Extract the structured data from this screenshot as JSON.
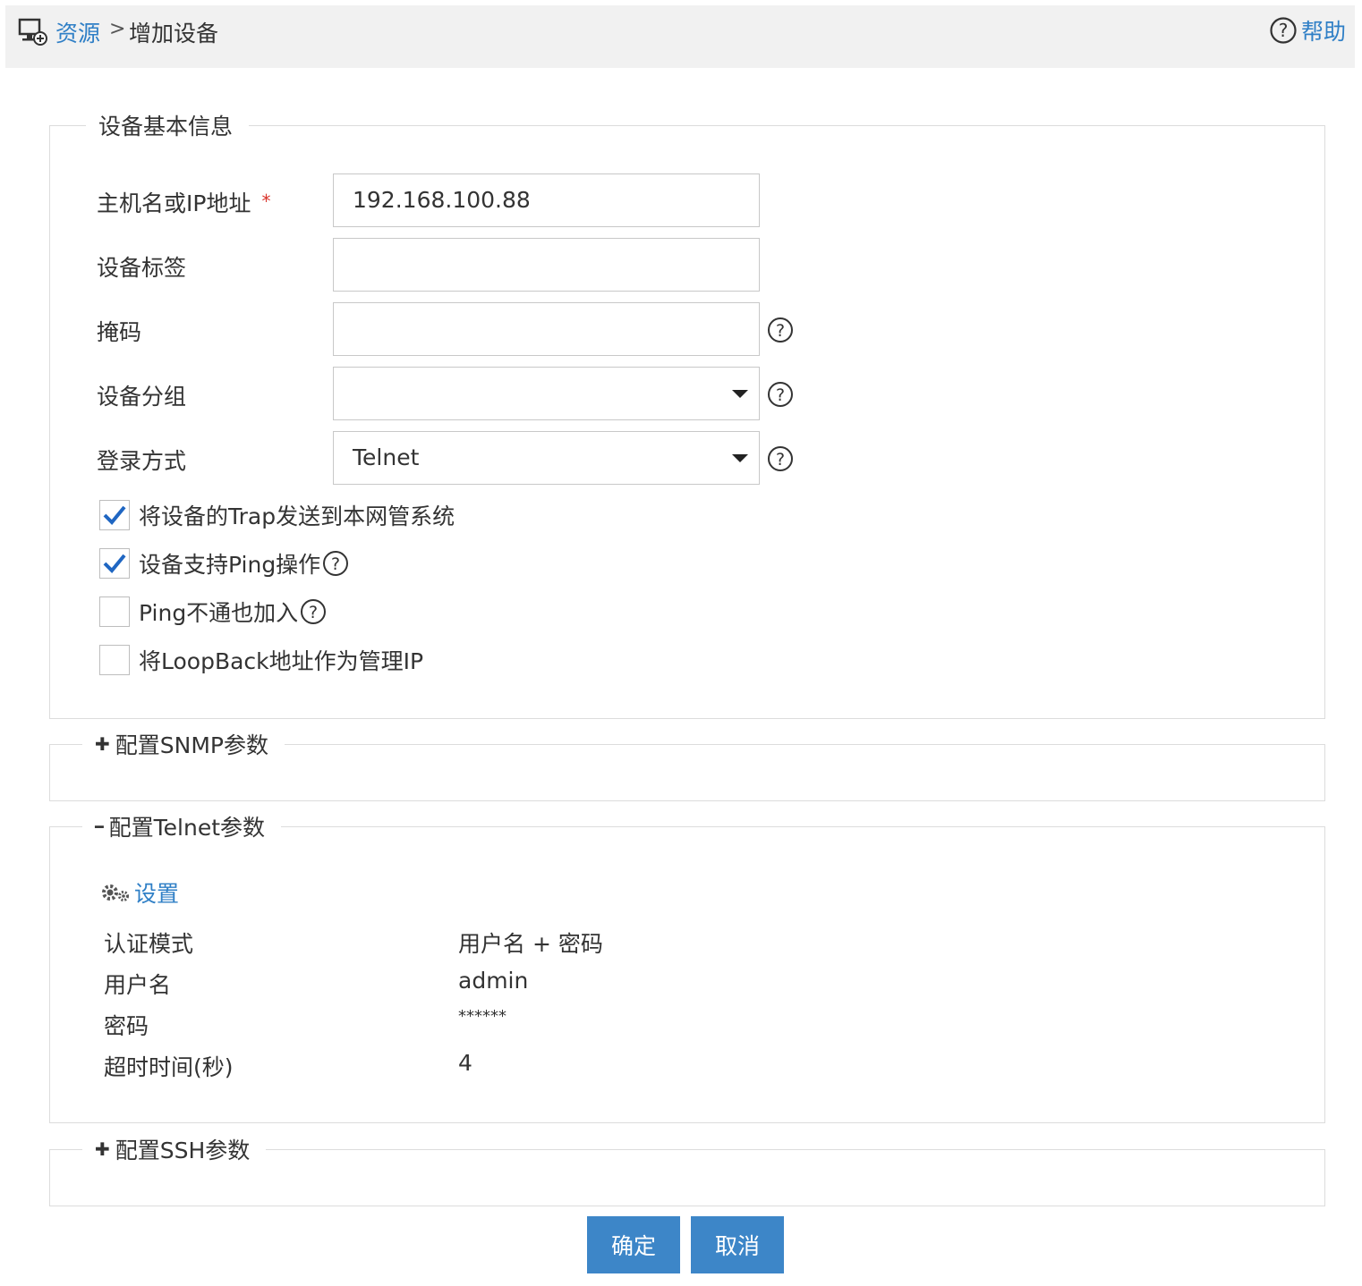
{
  "breadcrumb": {
    "root": "资源",
    "separator": ">",
    "current": "增加设备",
    "icon": "device-add-icon"
  },
  "help": {
    "label": "帮助",
    "icon": "question-circle-icon"
  },
  "basic": {
    "legend": "设备基本信息",
    "host": {
      "label": "主机名或IP地址",
      "required_mark": "*",
      "value": "192.168.100.88"
    },
    "tag": {
      "label": "设备标签",
      "value": ""
    },
    "mask": {
      "label": "掩码",
      "value": ""
    },
    "group": {
      "label": "设备分组",
      "value": ""
    },
    "login": {
      "label": "登录方式",
      "value": "Telnet"
    },
    "checkboxes": [
      {
        "label": "将设备的Trap发送到本网管系统",
        "checked": true
      },
      {
        "label": "设备支持Ping操作",
        "checked": true
      },
      {
        "label": "Ping不通也加入",
        "checked": false
      },
      {
        "label": "将LoopBack地址作为管理IP",
        "checked": false
      }
    ]
  },
  "snmp": {
    "toggle": "✚",
    "legend": "配置SNMP参数"
  },
  "telnet": {
    "toggle": "━",
    "legend": "配置Telnet参数",
    "settings_label": "设置",
    "rows": [
      {
        "key": "认证模式",
        "value": "用户名 + 密码"
      },
      {
        "key": "用户名",
        "value": "admin"
      },
      {
        "key": "密码",
        "value": "******"
      },
      {
        "key": "超时时间(秒)",
        "value": "4"
      }
    ]
  },
  "ssh": {
    "toggle": "✚",
    "legend": "配置SSH参数"
  },
  "buttons": {
    "ok": "确定",
    "cancel": "取消"
  },
  "colors": {
    "accent": "#3d86c8",
    "link": "#2f7fc6",
    "required": "#d9342b",
    "check": "#1f66c2"
  }
}
